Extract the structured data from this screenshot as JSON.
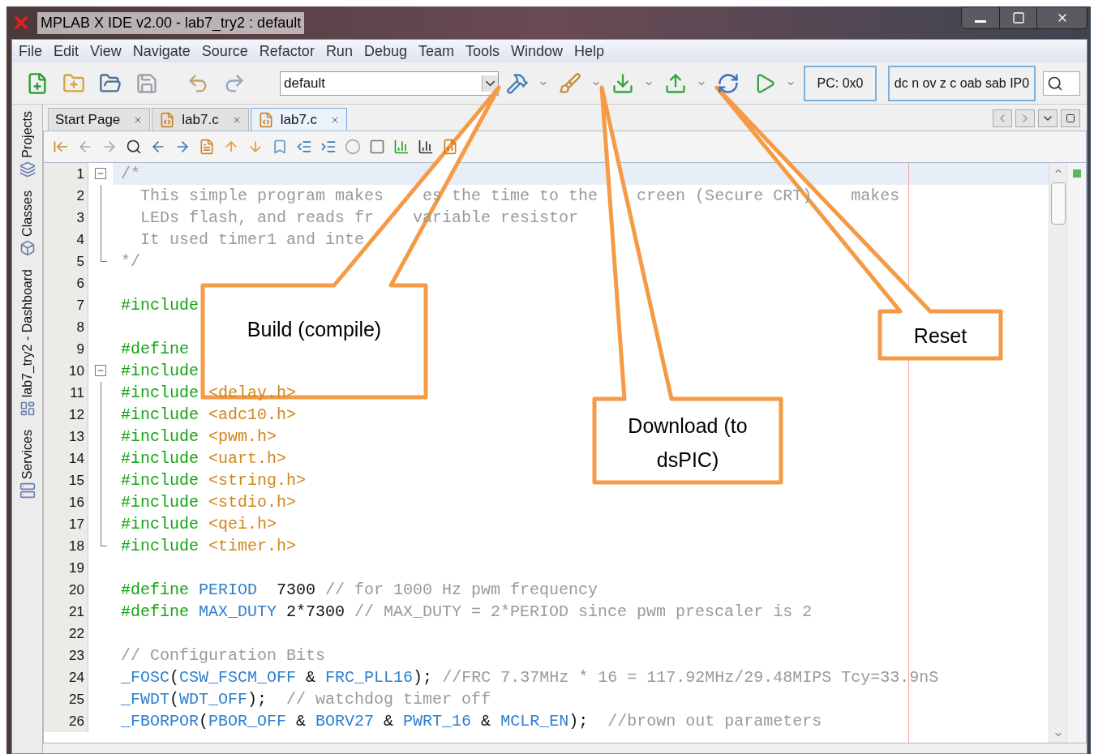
{
  "window": {
    "title": "MPLAB X IDE v2.00 - lab7_try2 : default"
  },
  "menu": [
    "File",
    "Edit",
    "View",
    "Navigate",
    "Source",
    "Refactor",
    "Run",
    "Debug",
    "Team",
    "Tools",
    "Window",
    "Help"
  ],
  "toolbar": {
    "configuration": "default",
    "pc": "PC: 0x0",
    "flags": "dc n ov z c oab sab IP0"
  },
  "side_tabs": [
    {
      "label": "Projects"
    },
    {
      "label": "Classes"
    },
    {
      "label": "lab7_try2 - Dashboard"
    },
    {
      "label": "Services"
    }
  ],
  "editor_tabs": [
    {
      "label": "Start Page",
      "selected": false,
      "file": false
    },
    {
      "label": "lab7.c",
      "selected": false,
      "file": true
    },
    {
      "label": "lab7.c",
      "selected": true,
      "file": true
    }
  ],
  "code": [
    {
      "num": "1",
      "current": true,
      "kind": "fold-start",
      "segs": [
        {
          "kind": "comment",
          "text": "/*"
        }
      ]
    },
    {
      "num": "2",
      "current": false,
      "kind": "fold-body",
      "segs": [
        {
          "kind": "comment",
          "text": "  This simple program makes"
        },
        {
          "kind": "comment",
          "text": "es the time to the",
          "after_gap": true
        },
        {
          "kind": "comment",
          "text": "creen (Secure CRT)",
          "after_gap": true
        },
        {
          "kind": "comment",
          "text": "makes",
          "after_gap": true
        }
      ]
    },
    {
      "num": "3",
      "current": false,
      "kind": "fold-body",
      "segs": [
        {
          "kind": "comment",
          "text": "  LEDs flash, and reads fr"
        },
        {
          "kind": "comment",
          "text": "variable resistor",
          "after_gap": true
        }
      ]
    },
    {
      "num": "4",
      "current": false,
      "kind": "fold-body",
      "segs": [
        {
          "kind": "comment",
          "text": "  It used timer1 and inte"
        }
      ]
    },
    {
      "num": "5",
      "current": false,
      "kind": "fold-end",
      "segs": [
        {
          "kind": "comment",
          "text": "*/"
        }
      ]
    },
    {
      "num": "6",
      "current": false,
      "kind": "plain"
    },
    {
      "num": "7",
      "current": false,
      "kind": "plain",
      "segs": [
        {
          "kind": "directive",
          "text": "#include"
        }
      ]
    },
    {
      "num": "8",
      "current": false,
      "kind": "plain"
    },
    {
      "num": "9",
      "current": false,
      "kind": "plain",
      "segs": [
        {
          "kind": "directive",
          "text": "#define"
        }
      ]
    },
    {
      "num": "10",
      "current": false,
      "kind": "fold-start",
      "segs": [
        {
          "kind": "directive",
          "text": "#include"
        }
      ]
    },
    {
      "num": "11",
      "current": false,
      "kind": "fold-body",
      "segs": [
        {
          "kind": "directive",
          "text": "#include "
        },
        {
          "kind": "header",
          "text": "<delay.h>"
        }
      ]
    },
    {
      "num": "12",
      "current": false,
      "kind": "fold-body",
      "segs": [
        {
          "kind": "directive",
          "text": "#include "
        },
        {
          "kind": "header",
          "text": "<adc10.h>"
        }
      ]
    },
    {
      "num": "13",
      "current": false,
      "kind": "fold-body",
      "segs": [
        {
          "kind": "directive",
          "text": "#include "
        },
        {
          "kind": "header",
          "text": "<pwm.h>"
        }
      ]
    },
    {
      "num": "14",
      "current": false,
      "kind": "fold-body",
      "segs": [
        {
          "kind": "directive",
          "text": "#include "
        },
        {
          "kind": "header",
          "text": "<uart.h>"
        }
      ]
    },
    {
      "num": "15",
      "current": false,
      "kind": "fold-body",
      "segs": [
        {
          "kind": "directive",
          "text": "#include "
        },
        {
          "kind": "header",
          "text": "<string.h>"
        }
      ]
    },
    {
      "num": "16",
      "current": false,
      "kind": "fold-body",
      "segs": [
        {
          "kind": "directive",
          "text": "#include "
        },
        {
          "kind": "header",
          "text": "<stdio.h>"
        }
      ]
    },
    {
      "num": "17",
      "current": false,
      "kind": "fold-body",
      "segs": [
        {
          "kind": "directive",
          "text": "#include "
        },
        {
          "kind": "header",
          "text": "<qei.h>"
        }
      ]
    },
    {
      "num": "18",
      "current": false,
      "kind": "fold-end",
      "segs": [
        {
          "kind": "directive",
          "text": "#include "
        },
        {
          "kind": "header",
          "text": "<timer.h>"
        }
      ]
    },
    {
      "num": "19",
      "current": false,
      "kind": "plain"
    },
    {
      "num": "20",
      "current": false,
      "kind": "plain",
      "segs": [
        {
          "kind": "directive",
          "text": "#define "
        },
        {
          "kind": "macro",
          "text": "PERIOD"
        },
        {
          "kind": "plain",
          "text": "  7300 "
        },
        {
          "kind": "comment",
          "text": "// for 1000 Hz pwm frequency"
        }
      ]
    },
    {
      "num": "21",
      "current": false,
      "kind": "plain",
      "segs": [
        {
          "kind": "directive",
          "text": "#define "
        },
        {
          "kind": "macro",
          "text": "MAX_DUTY"
        },
        {
          "kind": "plain",
          "text": " 2*7300 "
        },
        {
          "kind": "comment",
          "text": "// MAX_DUTY = 2*PERIOD since pwm prescaler is 2"
        }
      ]
    },
    {
      "num": "22",
      "current": false,
      "kind": "plain"
    },
    {
      "num": "23",
      "current": false,
      "kind": "plain",
      "segs": [
        {
          "kind": "comment",
          "text": "// Configuration Bits"
        }
      ]
    },
    {
      "num": "24",
      "current": false,
      "kind": "plain",
      "segs": [
        {
          "kind": "macro",
          "text": "_FOSC"
        },
        {
          "kind": "plain",
          "text": "("
        },
        {
          "kind": "macro",
          "text": "CSW_FSCM_OFF"
        },
        {
          "kind": "plain",
          "text": " & "
        },
        {
          "kind": "macro",
          "text": "FRC_PLL16"
        },
        {
          "kind": "plain",
          "text": "); "
        },
        {
          "kind": "comment",
          "text": "//FRC 7.37MHz * 16 = 117.92MHz/29.48MIPS Tcy=33.9nS"
        }
      ]
    },
    {
      "num": "25",
      "current": false,
      "kind": "plain",
      "segs": [
        {
          "kind": "macro",
          "text": "_FWDT"
        },
        {
          "kind": "plain",
          "text": "("
        },
        {
          "kind": "macro",
          "text": "WDT_OFF"
        },
        {
          "kind": "plain",
          "text": ");  "
        },
        {
          "kind": "comment",
          "text": "// watchdog timer off"
        }
      ]
    },
    {
      "num": "26",
      "current": false,
      "kind": "plain",
      "segs": [
        {
          "kind": "macro",
          "text": "_FBORPOR"
        },
        {
          "kind": "plain",
          "text": "("
        },
        {
          "kind": "macro",
          "text": "PBOR_OFF"
        },
        {
          "kind": "plain",
          "text": " & "
        },
        {
          "kind": "macro",
          "text": "BORV27"
        },
        {
          "kind": "plain",
          "text": " & "
        },
        {
          "kind": "macro",
          "text": "PWRT_16"
        },
        {
          "kind": "plain",
          "text": " & "
        },
        {
          "kind": "macro",
          "text": "MCLR_EN"
        },
        {
          "kind": "plain",
          "text": ");  "
        },
        {
          "kind": "comment",
          "text": "//brown out parameters"
        }
      ]
    }
  ],
  "callouts": [
    {
      "kind": "build",
      "lines": [
        "Build (compile)"
      ]
    },
    {
      "kind": "download",
      "lines": [
        "Download (to",
        "dsPIC)"
      ]
    },
    {
      "kind": "reset",
      "lines": [
        "Reset"
      ]
    }
  ]
}
